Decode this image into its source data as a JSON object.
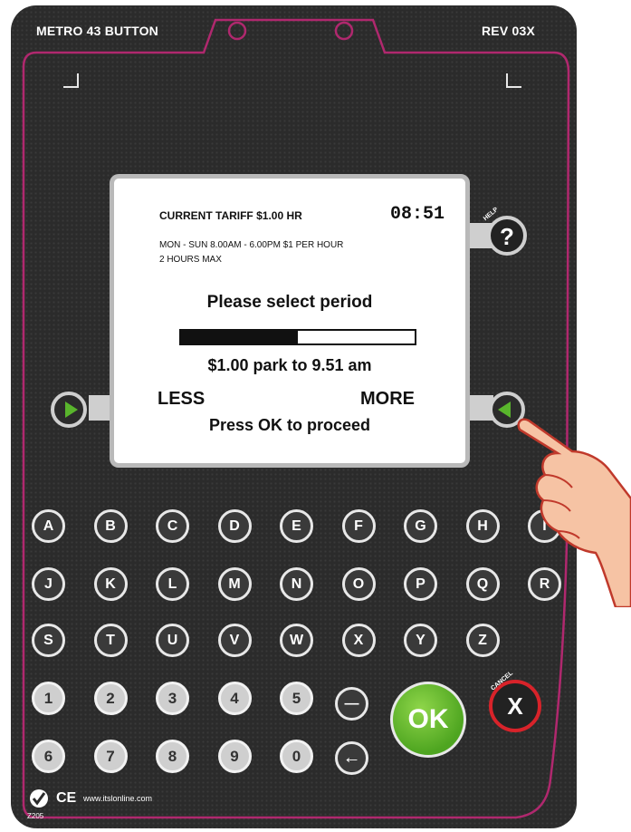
{
  "header": {
    "model": "METRO 43 BUTTON",
    "revision": "REV 03X"
  },
  "display": {
    "tariff": "CURRENT TARIFF $1.00 HR",
    "time": "08:51",
    "schedule": "MON - SUN  8.00AM - 6.00PM   $1 PER HOUR",
    "max": "2 HOURS  MAX",
    "prompt": "Please select period",
    "progress": 0.5,
    "amount": "$1.00  park to 9.51  am",
    "less": "LESS",
    "more": "MORE",
    "proceed": "Press OK to proceed"
  },
  "side_buttons": {
    "help_label": "HELP",
    "help_glyph": "?"
  },
  "keypad": {
    "row1": [
      "A",
      "B",
      "C",
      "D",
      "E",
      "F",
      "G",
      "H",
      "I"
    ],
    "row2": [
      "J",
      "K",
      "L",
      "M",
      "N",
      "O",
      "P",
      "Q",
      "R"
    ],
    "row3": [
      "S",
      "T",
      "U",
      "V",
      "W",
      "X",
      "Y",
      "Z"
    ],
    "row4": [
      "1",
      "2",
      "3",
      "4",
      "5"
    ],
    "row5": [
      "6",
      "7",
      "8",
      "9",
      "0"
    ],
    "ok_label": "OK",
    "cancel_label": "CANCEL",
    "cancel_glyph": "X",
    "space_glyph": "—",
    "back_glyph": "←"
  },
  "footer": {
    "url": "www.itslonline.com",
    "code": "Z205",
    "ce": "CE"
  },
  "colors": {
    "panel": "#2b2b2b",
    "trim": "#b0286e",
    "ok": "#5bb22a",
    "cancel": "#d8232a",
    "arrow": "#59b52c"
  }
}
